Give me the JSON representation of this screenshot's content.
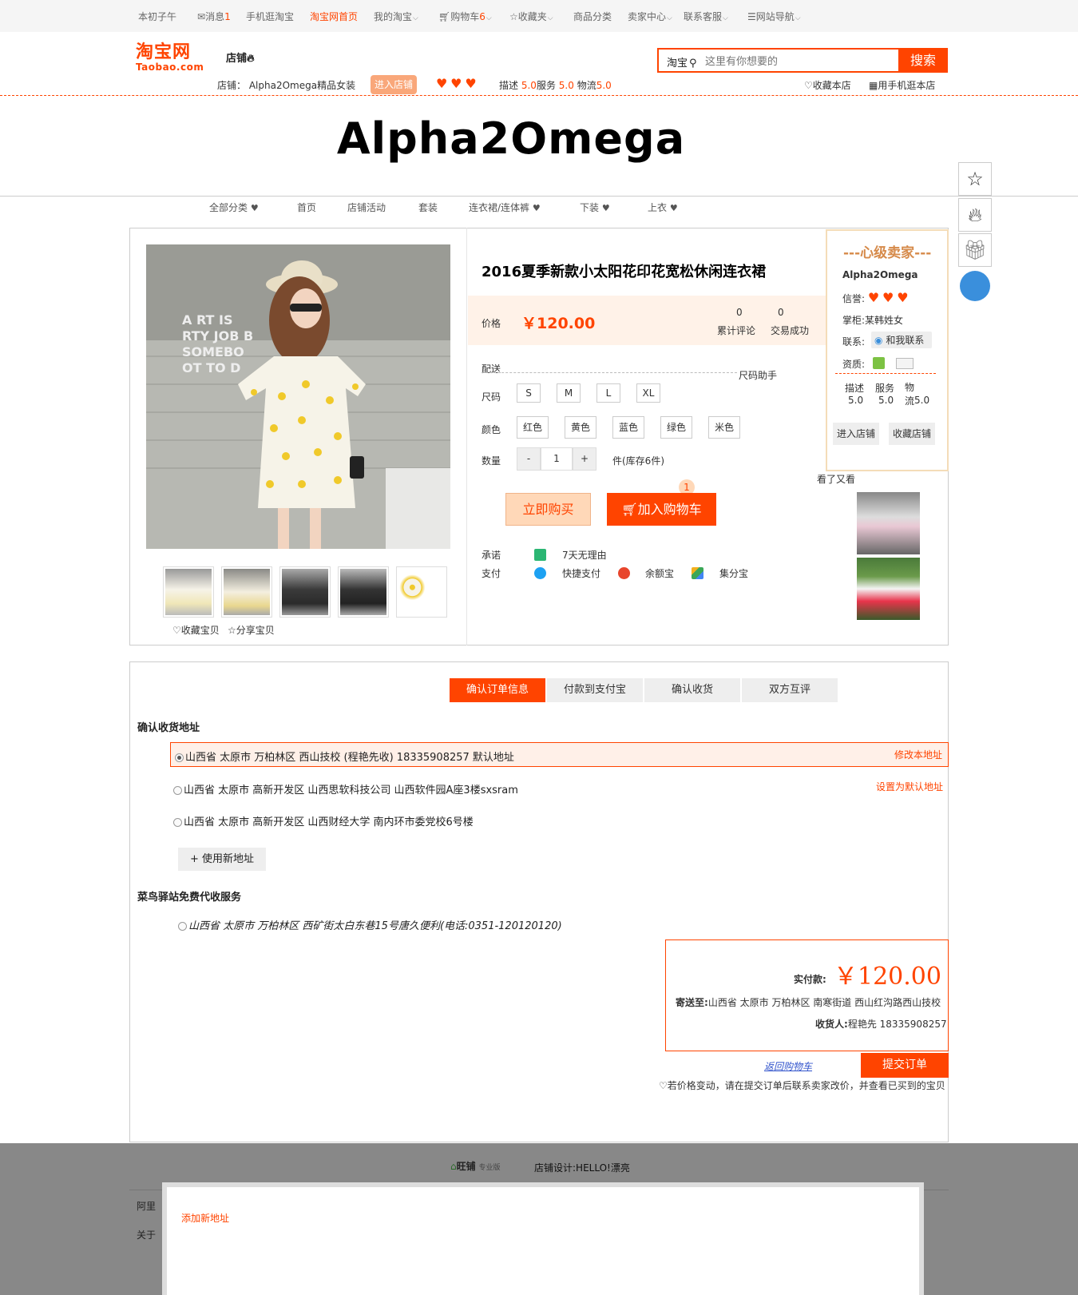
{
  "topbar": {
    "greeting": "本初子午",
    "messages": "消息",
    "messages_count": "1",
    "mobile": "手机逛淘宝",
    "home": "淘宝网首页",
    "my_taobao": "我的淘宝",
    "cart": "购物车",
    "cart_count": "6",
    "favorites": "收藏夹",
    "categories": "商品分类",
    "seller_center": "卖家中心",
    "service": "联系客服",
    "site_nav": "网站导航"
  },
  "header": {
    "logo_main": "淘宝网",
    "logo_sub": "Taobao.com",
    "shop_word": "店铺",
    "search_scope": "淘宝",
    "search_placeholder": "这里有你想要的",
    "search_button": "搜索",
    "shop_label": "店铺：",
    "shop_fullname": "Alpha2Omega精品女装",
    "enter_shop": "进入店铺",
    "rating_desc_label": "描述",
    "rating_desc": "5.0",
    "rating_service_label": "服务",
    "rating_service": "5.0",
    "rating_logistics_label": "物流",
    "rating_logistics": "5.0",
    "fav_shop": "收藏本店",
    "mobile_shop": "用手机逛本店"
  },
  "shop_banner": "Alpha2Omega",
  "shop_nav": [
    "全部分类",
    "首页",
    "店铺活动",
    "套装",
    "连衣裙/连体裤",
    "下装",
    "上衣"
  ],
  "product": {
    "title": "2016夏季新款小太阳花印花宽松休闲连衣裙",
    "price_label": "价格",
    "price": "￥120.00",
    "reviews_count": "0",
    "reviews_label": "累计评论",
    "sales_count": "0",
    "sales_label": "交易成功",
    "delivery_label": "配送",
    "size_helper": "尺码助手",
    "size_label": "尺码",
    "sizes": [
      "S",
      "M",
      "L",
      "XL"
    ],
    "color_label": "颜色",
    "colors": [
      "红色",
      "黄色",
      "蓝色",
      "绿色",
      "米色"
    ],
    "qty_label": "数量",
    "qty_minus": "-",
    "qty_value": "1",
    "qty_plus": "+",
    "stock": "件(库存6件)",
    "buy_now": "立即购买",
    "add_cart": "加入购物车",
    "cart_badge": "1",
    "promise_label": "承诺",
    "promise": "7天无理由",
    "pay_label": "支付",
    "pay_quick": "快捷支付",
    "pay_yue": "余额宝",
    "pay_jifen": "集分宝",
    "fav_item": "收藏宝贝",
    "share_item": "分享宝贝",
    "also_viewed": "看了又看"
  },
  "seller": {
    "title": "---心级卖家---",
    "name": "Alpha2Omega",
    "credit_label": "信誉:",
    "owner_label": "掌柜:",
    "owner": "某韩姓女",
    "contact_label": "联系:",
    "contact_btn": "和我联系",
    "qual_label": "资质:",
    "desc_label": "描述",
    "desc": "5.0",
    "service_label": "服务",
    "service": "5.0",
    "logistics_label": "物流",
    "logistics": "5.0",
    "enter_shop": "进入店铺",
    "fav_shop": "收藏店铺"
  },
  "order": {
    "steps": [
      "确认订单信息",
      "付款到支付宝",
      "确认收货",
      "双方互评"
    ],
    "address_title": "确认收货地址",
    "addresses": [
      "山西省 太原市 万柏林区 西山技校 (程艳先收) 18335908257 默认地址",
      "山西省 太原市 高新开发区 山西思软科技公司 山西软件园A座3楼sxsram",
      "山西省 太原市 高新开发区 山西财经大学 南内环市委党校6号楼"
    ],
    "edit_addr": "修改本地址",
    "set_default": "设置为默认地址",
    "new_addr": "+ 使用新地址",
    "cainiao_title": "菜鸟驿站免费代收服务",
    "cainiao_addr": "山西省 太原市 万柏林区 西矿街太白东巷15号唐久便利(电话:0351-120120120)",
    "pay_label": "实付款:",
    "pay_amount": "￥120.00",
    "ship_label": "寄送至:",
    "ship_to": "山西省 太原市 万柏林区 南寒街道 西山红沟路西山技校",
    "receiver_label": "收货人:",
    "receiver": "程艳先 18335908257",
    "back_cart": "返回购物车",
    "submit": "提交订单",
    "notice": "若价格变动，请在提交订单后联系卖家改价，并查看已买到的宝贝"
  },
  "footer": {
    "brand": "旺铺",
    "brand_sub": "专业版",
    "designer": "店铺设计:HELLO!漂亮",
    "link1": "阿里",
    "link2": "关于"
  },
  "modal": {
    "title": "添加新地址"
  }
}
